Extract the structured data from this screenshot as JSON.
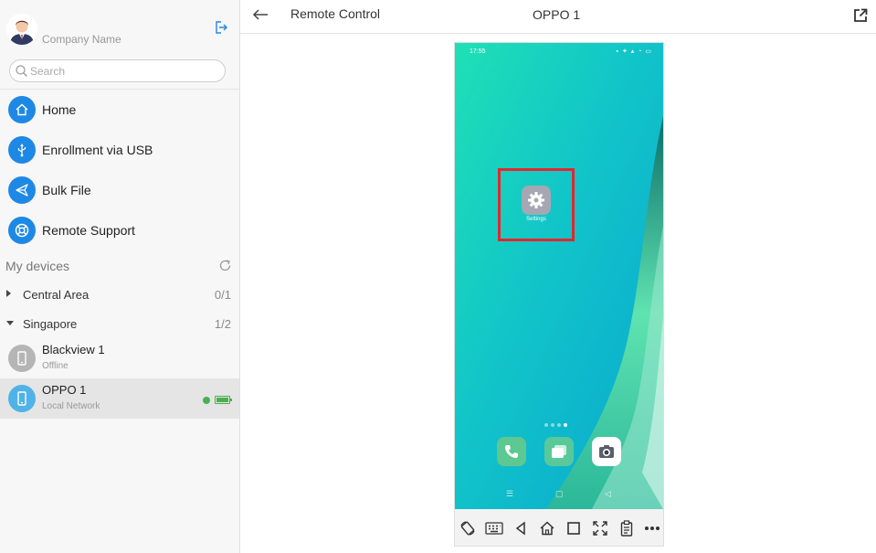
{
  "sidebar": {
    "company_name": "Company Name",
    "search_placeholder": "Search",
    "nav": [
      {
        "label": "Home",
        "icon": "home-icon"
      },
      {
        "label": "Enrollment via USB",
        "icon": "usb-icon"
      },
      {
        "label": "Bulk File",
        "icon": "send-icon"
      },
      {
        "label": "Remote Support",
        "icon": "lifebuoy-icon"
      }
    ],
    "devices_title": "My devices",
    "groups": [
      {
        "label": "Central Area",
        "count": "0/1",
        "expanded": false
      },
      {
        "label": "Singapore",
        "count": "1/2",
        "expanded": true
      }
    ],
    "devices": [
      {
        "name": "Blackview 1",
        "status": "Offline"
      },
      {
        "name": "OPPO 1",
        "status": "Local Network"
      }
    ]
  },
  "main": {
    "page_title": "Remote Control",
    "device_title": "OPPO 1",
    "phone": {
      "time": "17:55",
      "settings_label": "Settings"
    }
  },
  "colors": {
    "accent": "#1e88e5",
    "highlight": "#e5262d",
    "online": "#4caf50"
  }
}
